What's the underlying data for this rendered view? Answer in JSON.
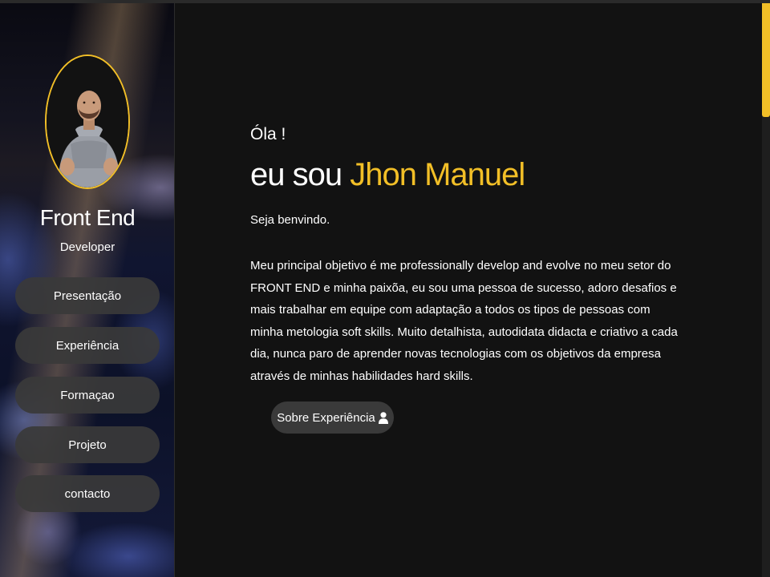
{
  "sidebar": {
    "title": "Front End",
    "subtitle": "Developer",
    "nav": [
      {
        "label": "Presentação"
      },
      {
        "label": "Experiência"
      },
      {
        "label": "Formaçao"
      },
      {
        "label": "Projeto"
      },
      {
        "label": "contacto"
      }
    ]
  },
  "main": {
    "greeting": "Óla !",
    "headline_prefix": "eu sou ",
    "name": "Jhon Manuel",
    "welcome": "Seja benvindo.",
    "description": "Meu principal objetivo é me professionally develop and evolve no meu setor do FRONT END e minha paixõa, eu sou uma pessoa de sucesso, adoro desafios e mais trabalhar em equipe com adaptação a todos os tipos de pessoas com minha metologia soft skills. Muito detalhista, autodidata didacta e criativo a cada dia, nunca paro de aprender novas tecnologias com os objetivos da empresa através de minhas habilidades hard skills.",
    "cta_label": "Sobre Experiência",
    "cta_icon": "user-icon"
  },
  "colors": {
    "accent": "#f2bf27",
    "background": "#121212",
    "button": "#3a3a3a"
  }
}
